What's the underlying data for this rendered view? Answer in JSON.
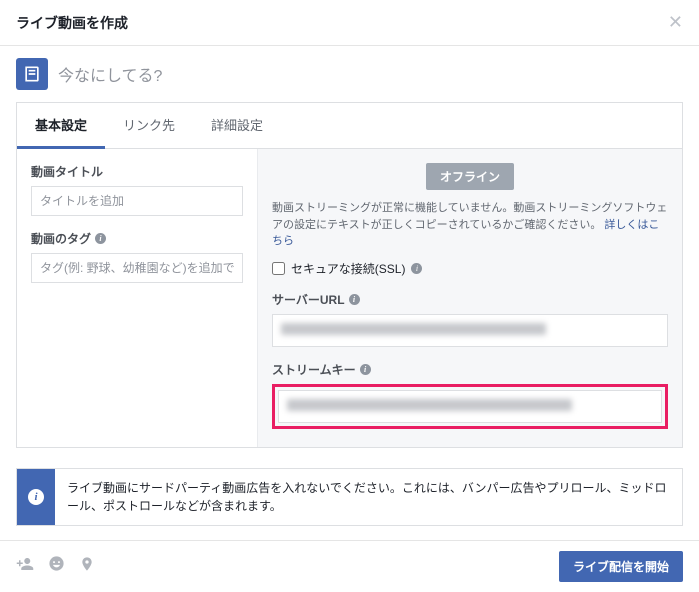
{
  "header": {
    "title": "ライブ動画を作成"
  },
  "composer": {
    "placeholder": "今なにしてる?"
  },
  "tabs": {
    "basic": "基本設定",
    "link": "リンク先",
    "advanced": "詳細設定"
  },
  "left": {
    "title_label": "動画タイトル",
    "title_placeholder": "タイトルを追加",
    "tag_label": "動画のタグ",
    "tag_placeholder": "タグ(例: 野球、幼稚園など)を追加できます。"
  },
  "right": {
    "offline_badge": "オフライン",
    "stream_warning": "動画ストリーミングが正常に機能していません。動画ストリーミングソフトウェアの設定にテキストが正しくコピーされているかご確認ください。",
    "learn_more": "詳しくはこちら",
    "secure_label": "セキュアな接続(SSL)",
    "server_url_label": "サーバーURL",
    "stream_key_label": "ストリームキー"
  },
  "notice": "ライブ動画にサードパーティ動画広告を入れないでください。これには、バンパー広告やプリロール、ミッドロール、ポストロールなどが含まれます。",
  "footer": {
    "go_live": "ライブ配信を開始"
  }
}
